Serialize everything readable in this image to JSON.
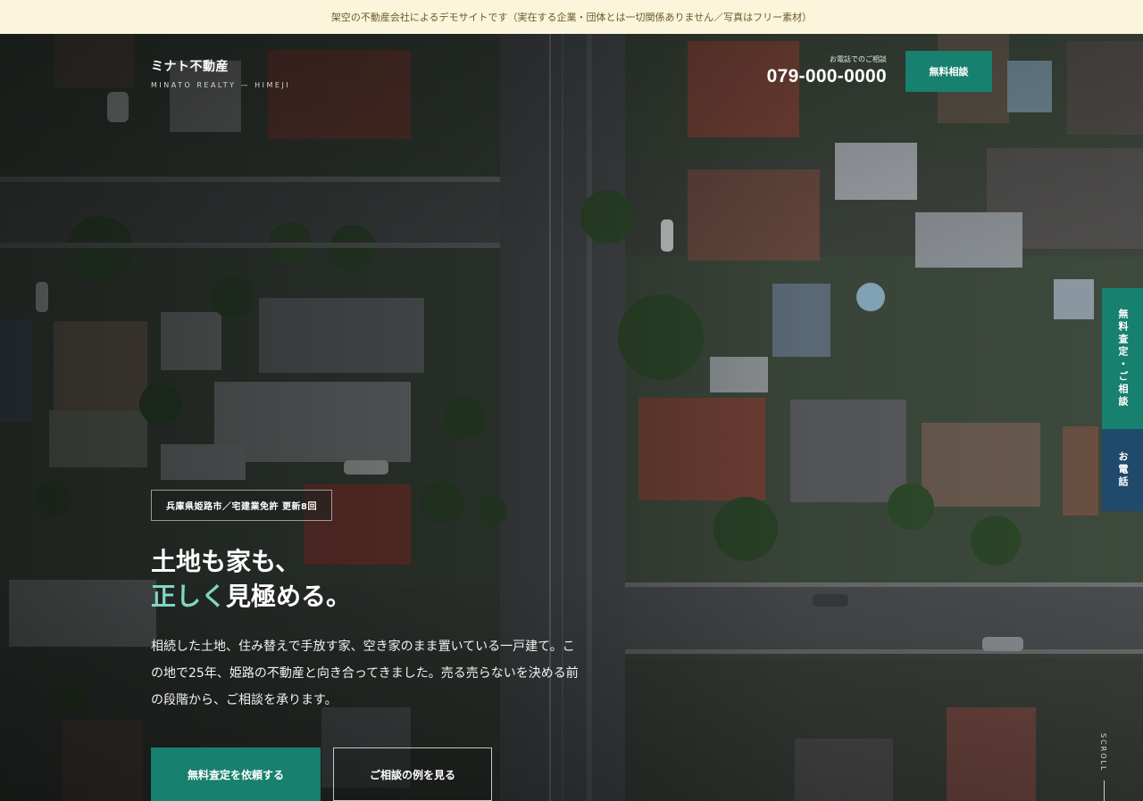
{
  "notice": "架空の不動産会社によるデモサイトです（実在する企業・団体とは一切関係ありません／写真はフリー素材）",
  "brand": {
    "name": "ミナト不動産",
    "sub": "MINATO REALTY — HIMEJI"
  },
  "contact": {
    "label": "お電話でのご相談",
    "phone": "079-000-0000",
    "cta": "無料相談"
  },
  "side_tabs": {
    "assess": "無料査定・ご相談",
    "call": "お電話"
  },
  "hero": {
    "badge": "兵庫県姫路市／宅建業免許 更新8回",
    "headline_line1": "土地も家も、",
    "headline_accent": "正しく",
    "headline_rest": "見極める。",
    "lead": "相続した土地、住み替えで手放す家、空き家のまま置いている一戸建て。この地で25年、姫路の不動産と向き合ってきました。売る売らないを決める前の段階から、ご相談を承ります。",
    "primary_button": "無料査定を依頼する",
    "secondary_button": "ご相談の例を見る"
  },
  "scroll_label": "SCROLL",
  "colors": {
    "accent": "#17806e",
    "accent_text": "#7fd6c3",
    "navy": "#204a6b",
    "notice_bg": "#fbf5dc"
  }
}
